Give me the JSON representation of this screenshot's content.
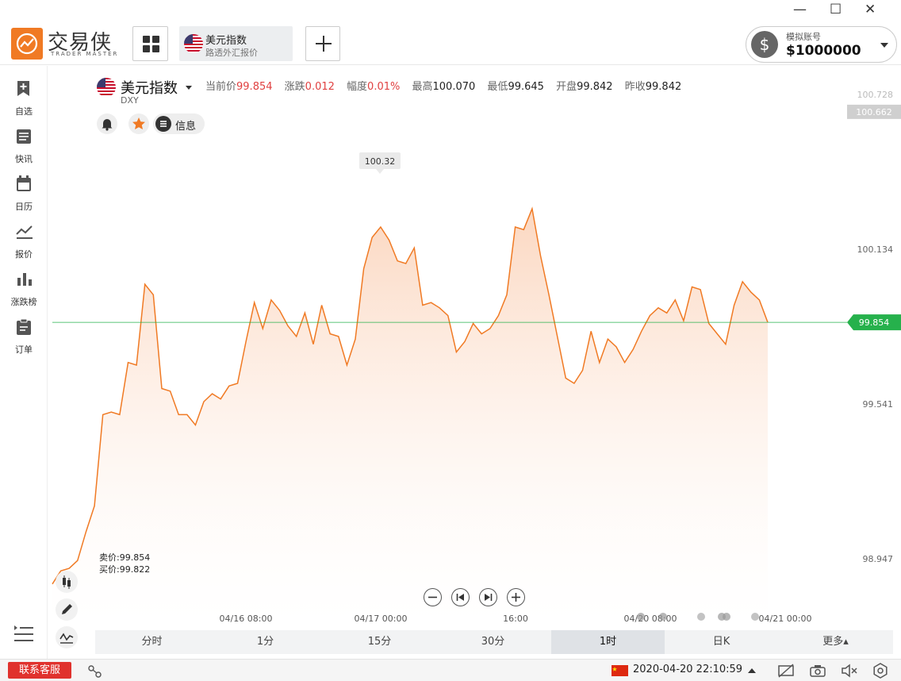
{
  "app": {
    "brand": "交易侠",
    "brand_sub": "TRADER MASTER",
    "window_controls": [
      "—",
      "☐",
      "✕"
    ]
  },
  "tabs": [
    {
      "title": "美元指数",
      "subtitle": "路透外汇报价"
    }
  ],
  "account": {
    "label": "模拟账号",
    "balance": "$1000000"
  },
  "sidebar": {
    "items": [
      {
        "label": "自选",
        "icon": "bookmark-add-icon"
      },
      {
        "label": "快讯",
        "icon": "news-list-icon"
      },
      {
        "label": "日历",
        "icon": "calendar-icon"
      },
      {
        "label": "报价",
        "icon": "line-chart-icon"
      },
      {
        "label": "涨跌榜",
        "icon": "bar-chart-icon"
      },
      {
        "label": "订单",
        "icon": "clipboard-icon"
      }
    ]
  },
  "instrument": {
    "name": "美元指数",
    "code": "DXY",
    "stats": [
      {
        "label": "当前价",
        "value": "99.854",
        "tone": "red"
      },
      {
        "label": "涨跌",
        "value": "0.012",
        "tone": "red"
      },
      {
        "label": "幅度",
        "value": "0.01%",
        "tone": "red"
      },
      {
        "label": "最高",
        "value": "100.070",
        "tone": "dark"
      },
      {
        "label": "最低",
        "value": "99.645",
        "tone": "dark"
      },
      {
        "label": "开盘",
        "value": "99.842",
        "tone": "dark"
      },
      {
        "label": "昨收",
        "value": "99.842",
        "tone": "dark"
      }
    ],
    "info_label": "信息"
  },
  "quote": {
    "sell_label": "卖价:99.854",
    "buy_label": "买价:99.822"
  },
  "chart_data": {
    "type": "area",
    "series": [
      {
        "values": [
          98.85,
          98.9,
          98.91,
          98.94,
          99.05,
          99.15,
          99.5,
          99.51,
          99.5,
          99.7,
          99.69,
          100.0,
          99.96,
          99.6,
          99.59,
          99.5,
          99.5,
          99.46,
          99.55,
          99.58,
          99.56,
          99.61,
          99.62,
          99.78,
          99.93,
          99.83,
          99.94,
          99.9,
          99.84,
          99.8,
          99.89,
          99.77,
          99.92,
          99.81,
          99.8,
          99.69,
          99.79,
          100.06,
          100.18,
          100.22,
          100.17,
          100.09,
          100.08,
          100.14,
          99.92,
          99.93,
          99.91,
          99.88,
          99.74,
          99.78,
          99.85,
          99.81,
          99.83,
          99.88,
          99.96,
          100.22,
          100.21,
          100.29,
          100.11,
          99.96,
          99.8,
          99.64,
          99.62,
          99.67,
          99.82,
          99.7,
          99.79,
          99.76,
          99.7,
          99.75,
          99.82,
          99.88,
          99.91,
          99.89,
          99.94,
          99.86,
          99.99,
          99.98,
          99.85,
          99.81,
          99.77,
          99.92,
          100.01,
          99.97,
          99.94,
          99.854
        ]
      }
    ],
    "y_ticks": [
      "100.728",
      "100.662",
      "100.134",
      "99.854",
      "99.541",
      "98.947"
    ],
    "x_ticks": [
      "04/16 08:00",
      "04/17 00:00",
      "16:00",
      "04/20 08:00",
      "04/21 00:00"
    ],
    "ylim": [
      98.7,
      100.75
    ],
    "current_price": "99.854",
    "highlight_label": "100.32",
    "highlight_value": 100.29,
    "highlight_index": 57,
    "highlight_index_span": 85,
    "colors": {
      "line": "#f07a24",
      "fill": "#fbd5bd",
      "current": "#26b14c",
      "muted": "#cfcfcf"
    }
  },
  "timeframes": [
    "分时",
    "1分",
    "15分",
    "30分",
    "1时",
    "日K",
    "更多▴"
  ],
  "active_timeframe": "1时",
  "status_bar": {
    "customer_service": "联系客服",
    "datetime": "2020-04-20 22:10:59"
  }
}
